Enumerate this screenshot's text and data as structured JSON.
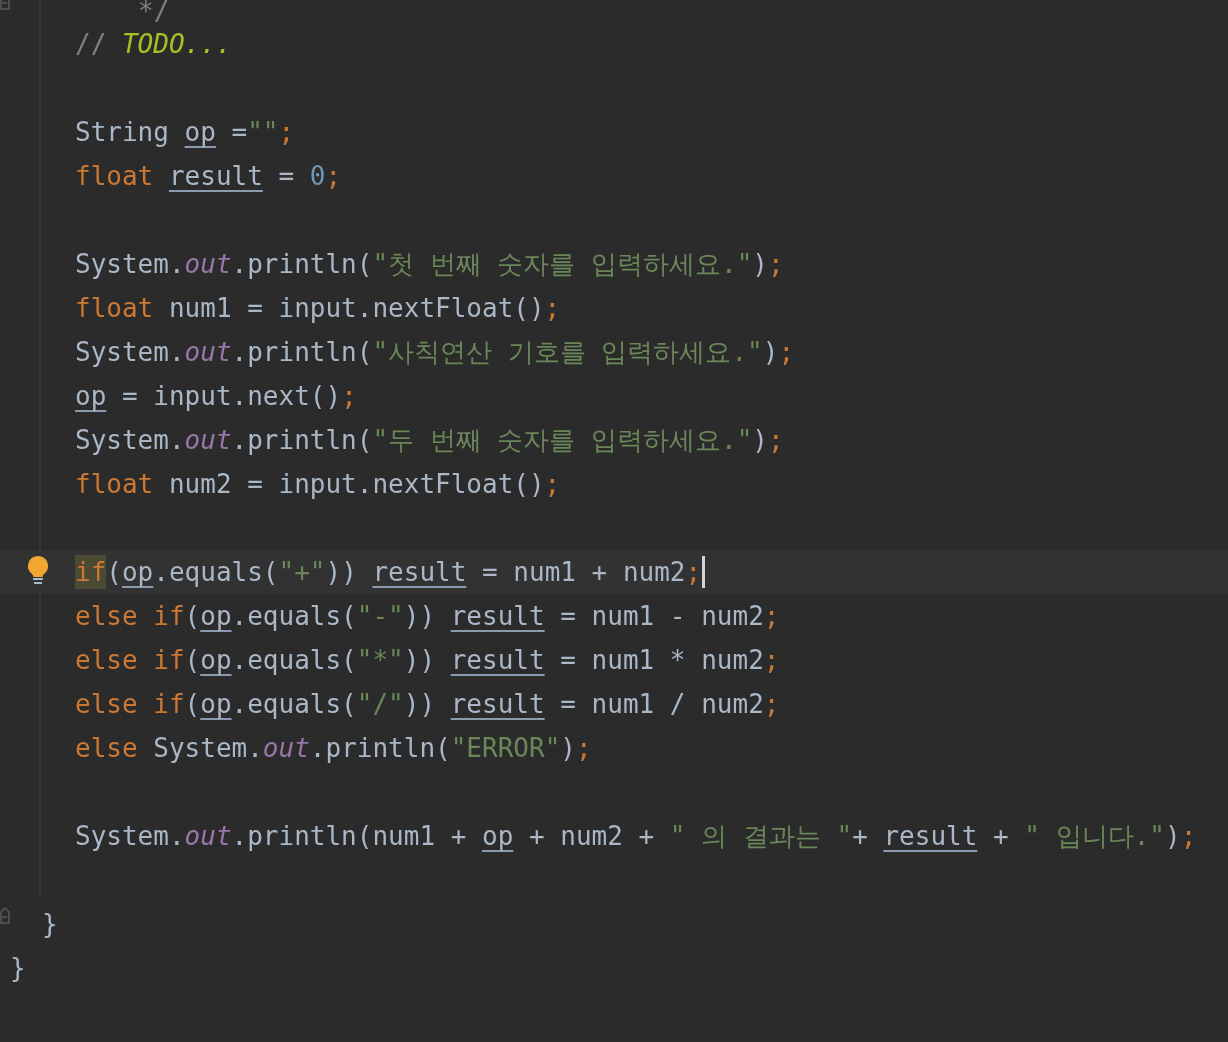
{
  "editor": {
    "lines": [
      {
        "kind": "doc_end",
        "current": false,
        "tokens": [
          {
            "kind": "comment",
            "text": "*/"
          }
        ]
      },
      {
        "kind": "code",
        "current": false,
        "tokens": [
          {
            "kind": "comment",
            "text": "// "
          },
          {
            "kind": "todo",
            "text": "TODO..."
          }
        ]
      },
      {
        "kind": "blank",
        "current": false
      },
      {
        "kind": "code",
        "current": false,
        "tokens": [
          {
            "kind": "plain",
            "text": "String "
          },
          {
            "kind": "var",
            "text": "op"
          },
          {
            "kind": "plain",
            "text": " ="
          },
          {
            "kind": "string",
            "text": "\"\""
          },
          {
            "kind": "punct",
            "text": ";"
          }
        ]
      },
      {
        "kind": "code",
        "current": false,
        "tokens": [
          {
            "kind": "keyword",
            "text": "float "
          },
          {
            "kind": "var",
            "text": "result"
          },
          {
            "kind": "plain",
            "text": " = "
          },
          {
            "kind": "number",
            "text": "0"
          },
          {
            "kind": "punct",
            "text": ";"
          }
        ]
      },
      {
        "kind": "blank",
        "current": false
      },
      {
        "kind": "code",
        "current": false,
        "tokens": [
          {
            "kind": "plain",
            "text": "System."
          },
          {
            "kind": "field",
            "text": "out"
          },
          {
            "kind": "plain",
            "text": ".println("
          },
          {
            "kind": "string",
            "text": "\"첫 번째 숫자를 입력하세요.\""
          },
          {
            "kind": "plain",
            "text": ")"
          },
          {
            "kind": "punct",
            "text": ";"
          }
        ]
      },
      {
        "kind": "code",
        "current": false,
        "tokens": [
          {
            "kind": "keyword",
            "text": "float "
          },
          {
            "kind": "plain",
            "text": "num1 = input.nextFloat()"
          },
          {
            "kind": "punct",
            "text": ";"
          }
        ]
      },
      {
        "kind": "code",
        "current": false,
        "tokens": [
          {
            "kind": "plain",
            "text": "System."
          },
          {
            "kind": "field",
            "text": "out"
          },
          {
            "kind": "plain",
            "text": ".println("
          },
          {
            "kind": "string",
            "text": "\"사칙연산 기호를 입력하세요.\""
          },
          {
            "kind": "plain",
            "text": ")"
          },
          {
            "kind": "punct",
            "text": ";"
          }
        ]
      },
      {
        "kind": "code",
        "current": false,
        "tokens": [
          {
            "kind": "var",
            "text": "op"
          },
          {
            "kind": "plain",
            "text": " = input.next()"
          },
          {
            "kind": "punct",
            "text": ";"
          }
        ]
      },
      {
        "kind": "code",
        "current": false,
        "tokens": [
          {
            "kind": "plain",
            "text": "System."
          },
          {
            "kind": "field",
            "text": "out"
          },
          {
            "kind": "plain",
            "text": ".println("
          },
          {
            "kind": "string",
            "text": "\"두 번째 숫자를 입력하세요.\""
          },
          {
            "kind": "plain",
            "text": ")"
          },
          {
            "kind": "punct",
            "text": ";"
          }
        ]
      },
      {
        "kind": "code",
        "current": false,
        "tokens": [
          {
            "kind": "keyword",
            "text": "float "
          },
          {
            "kind": "plain",
            "text": "num2 = input.nextFloat()"
          },
          {
            "kind": "punct",
            "text": ";"
          }
        ]
      },
      {
        "kind": "blank",
        "current": false
      },
      {
        "kind": "code",
        "current": true,
        "tokens": [
          {
            "kind": "keyword_match",
            "text": "if"
          },
          {
            "kind": "plain",
            "text": "("
          },
          {
            "kind": "var",
            "text": "op"
          },
          {
            "kind": "plain",
            "text": ".equals("
          },
          {
            "kind": "string",
            "text": "\"+\""
          },
          {
            "kind": "plain",
            "text": ")) "
          },
          {
            "kind": "var",
            "text": "result"
          },
          {
            "kind": "plain",
            "text": " = num1 + num2"
          },
          {
            "kind": "punct",
            "text": ";"
          }
        ]
      },
      {
        "kind": "code",
        "current": false,
        "tokens": [
          {
            "kind": "keyword",
            "text": "else if"
          },
          {
            "kind": "plain",
            "text": "("
          },
          {
            "kind": "var",
            "text": "op"
          },
          {
            "kind": "plain",
            "text": ".equals("
          },
          {
            "kind": "string",
            "text": "\"-\""
          },
          {
            "kind": "plain",
            "text": ")) "
          },
          {
            "kind": "var",
            "text": "result"
          },
          {
            "kind": "plain",
            "text": " = num1 - num2"
          },
          {
            "kind": "punct",
            "text": ";"
          }
        ]
      },
      {
        "kind": "code",
        "current": false,
        "tokens": [
          {
            "kind": "keyword",
            "text": "else if"
          },
          {
            "kind": "plain",
            "text": "("
          },
          {
            "kind": "var",
            "text": "op"
          },
          {
            "kind": "plain",
            "text": ".equals("
          },
          {
            "kind": "string",
            "text": "\"*\""
          },
          {
            "kind": "plain",
            "text": ")) "
          },
          {
            "kind": "var",
            "text": "result"
          },
          {
            "kind": "plain",
            "text": " = num1 * num2"
          },
          {
            "kind": "punct",
            "text": ";"
          }
        ]
      },
      {
        "kind": "code",
        "current": false,
        "tokens": [
          {
            "kind": "keyword",
            "text": "else if"
          },
          {
            "kind": "plain",
            "text": "("
          },
          {
            "kind": "var",
            "text": "op"
          },
          {
            "kind": "plain",
            "text": ".equals("
          },
          {
            "kind": "string",
            "text": "\"/\""
          },
          {
            "kind": "plain",
            "text": ")) "
          },
          {
            "kind": "var",
            "text": "result"
          },
          {
            "kind": "plain",
            "text": " = num1 / num2"
          },
          {
            "kind": "punct",
            "text": ";"
          }
        ]
      },
      {
        "kind": "code",
        "current": false,
        "tokens": [
          {
            "kind": "keyword",
            "text": "else "
          },
          {
            "kind": "plain",
            "text": "System."
          },
          {
            "kind": "field",
            "text": "out"
          },
          {
            "kind": "plain",
            "text": ".println("
          },
          {
            "kind": "string",
            "text": "\"ERROR\""
          },
          {
            "kind": "plain",
            "text": ")"
          },
          {
            "kind": "punct",
            "text": ";"
          }
        ]
      },
      {
        "kind": "blank",
        "current": false
      },
      {
        "kind": "code",
        "current": false,
        "tokens": [
          {
            "kind": "plain",
            "text": "System."
          },
          {
            "kind": "field",
            "text": "out"
          },
          {
            "kind": "plain",
            "text": ".println(num1 + "
          },
          {
            "kind": "var",
            "text": "op"
          },
          {
            "kind": "plain",
            "text": " + num2 + "
          },
          {
            "kind": "string",
            "text": "\" 의 결과는 \""
          },
          {
            "kind": "plain",
            "text": "+ "
          },
          {
            "kind": "var",
            "text": "result"
          },
          {
            "kind": "plain",
            "text": " + "
          },
          {
            "kind": "string",
            "text": "\" 입니다.\""
          },
          {
            "kind": "plain",
            "text": ")"
          },
          {
            "kind": "punct",
            "text": ";"
          }
        ]
      },
      {
        "kind": "blank",
        "current": false
      },
      {
        "kind": "brace_inner",
        "current": false,
        "tokens": [
          {
            "kind": "plain",
            "text": "}"
          }
        ]
      },
      {
        "kind": "brace_outer",
        "current": false,
        "tokens": [
          {
            "kind": "plain",
            "text": "}"
          }
        ]
      }
    ]
  }
}
